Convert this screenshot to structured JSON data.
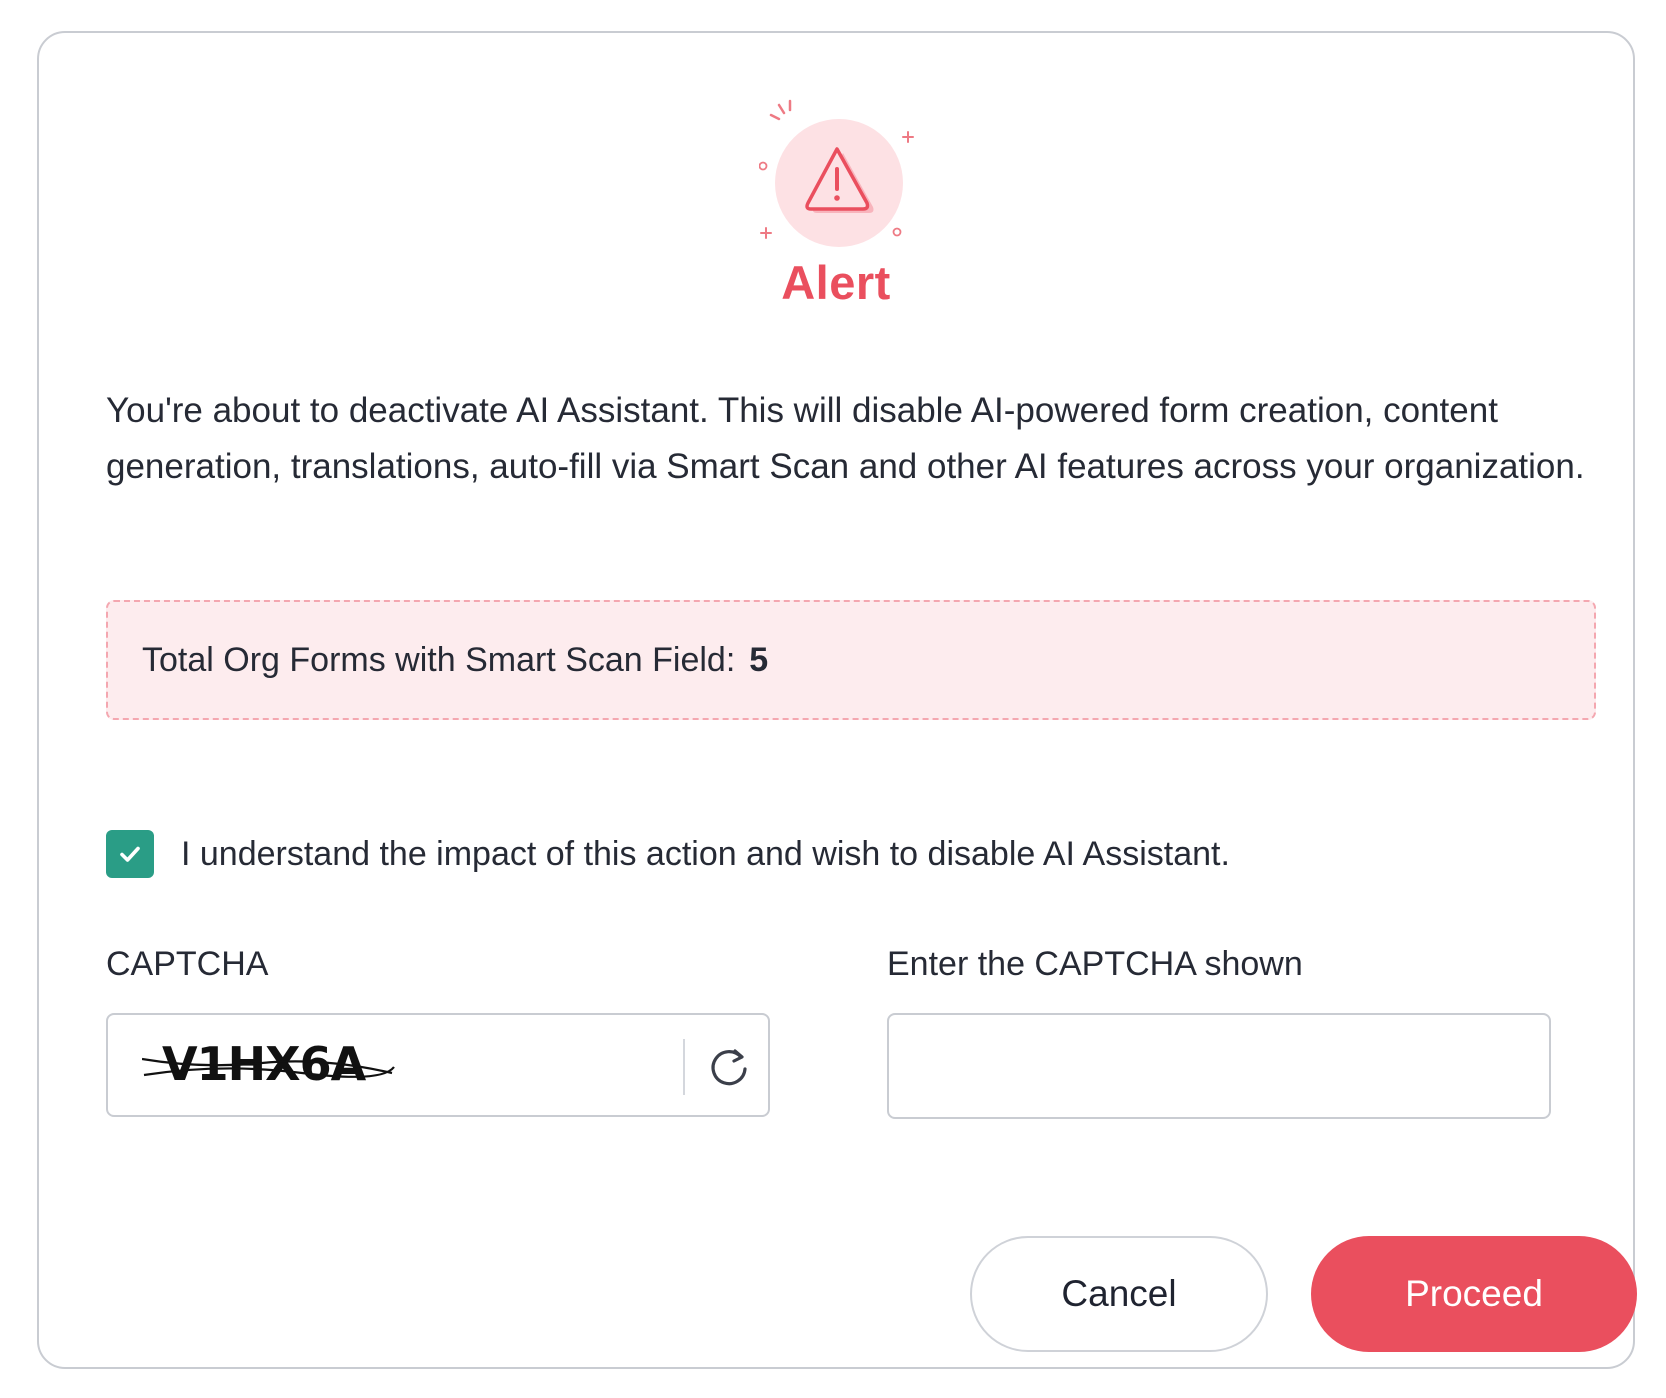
{
  "dialog": {
    "title": "Alert",
    "alert_icon": "warning-triangle-icon",
    "message": "You're about to deactivate AI Assistant. This will disable AI-powered form creation, content generation, translations, auto-fill via Smart Scan and other AI features across your organization.",
    "info": {
      "label": "Total Org Forms with Smart Scan Field:",
      "count": "5"
    },
    "consent": {
      "checked": true,
      "label": "I understand the impact of this action and wish to disable AI Assistant."
    },
    "captcha": {
      "label": "CAPTCHA",
      "code": "V1HX6A",
      "refresh_icon": "refresh-icon"
    },
    "captcha_input": {
      "label": "Enter the CAPTCHA shown",
      "value": "",
      "placeholder": ""
    },
    "buttons": {
      "cancel": "Cancel",
      "proceed": "Proceed"
    }
  },
  "colors": {
    "accent": "#ea4f5e",
    "checkbox": "#2a9d86",
    "info_background": "#fdecee",
    "info_border": "#f4a7b0",
    "border": "#c9ccd2"
  }
}
